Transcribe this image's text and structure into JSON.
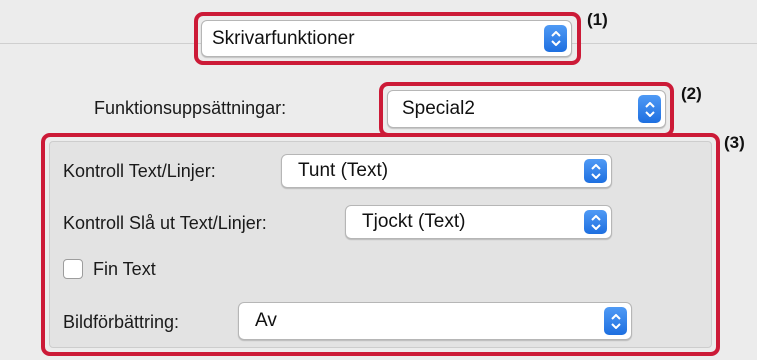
{
  "callouts": {
    "c1": "(1)",
    "c2": "(2)",
    "c3": "(3)"
  },
  "printer_features_popup": {
    "value": "Skrivarfunktioner"
  },
  "feature_sets": {
    "label": "Funktionsuppsättningar:",
    "value": "Special2"
  },
  "text_line_control": {
    "label": "Kontroll Text/Linjer:",
    "value": "Tunt (Text)"
  },
  "text_line_knockout": {
    "label": "Kontroll Slå ut Text/Linjer:",
    "value": "Tjockt (Text)"
  },
  "fine_text": {
    "label": "Fin Text",
    "checked": false
  },
  "image_enhancement": {
    "label": "Bildförbättring:",
    "value": "Av"
  },
  "colors": {
    "highlight": "#cc1a37",
    "stepper": "#1e6fe0"
  },
  "icons": {
    "stepper": "chevron-up-down-icon",
    "checkbox": "checkbox-unchecked-icon"
  }
}
